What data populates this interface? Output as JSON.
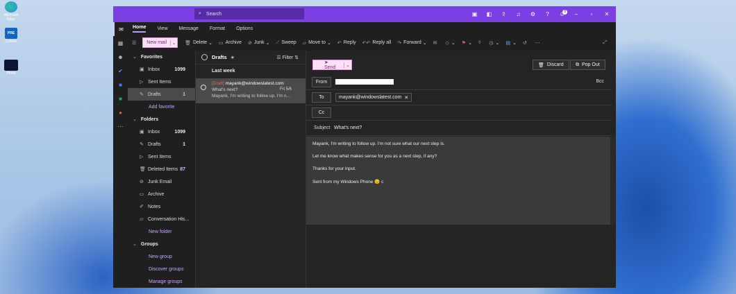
{
  "desktop": {
    "icons": [
      {
        "label": "Microsoft Edge",
        "color": "#1f8fe0"
      },
      {
        "label": "Outlook",
        "color": "#1565c0",
        "badge": "PRE"
      },
      {
        "label": "Photo",
        "color": "#0b1633"
      }
    ]
  },
  "titlebar": {
    "search_placeholder": "Search",
    "accent": "#7b3fe4",
    "icons": [
      "teams-icon",
      "word-icon",
      "share-icon",
      "bell-icon",
      "settings-icon",
      "help-icon",
      "feedback-icon"
    ],
    "badge_count": "3"
  },
  "tabs": [
    "Home",
    "View",
    "Message",
    "Format",
    "Options"
  ],
  "active_tab": "Home",
  "ribbon": {
    "new_mail": "New mail",
    "delete": "Delete",
    "archive": "Archive",
    "junk": "Junk",
    "sweep": "Sweep",
    "move_to": "Move to",
    "reply": "Reply",
    "reply_all": "Reply all",
    "forward": "Forward"
  },
  "favorites": {
    "header": "Favorites",
    "items": [
      {
        "label": "Inbox",
        "count": "1099",
        "icon": "inbox-icon"
      },
      {
        "label": "Sent Items",
        "count": "",
        "icon": "send-icon"
      },
      {
        "label": "Drafts",
        "count": "1",
        "icon": "drafts-icon",
        "selected": true
      }
    ],
    "add_favorite": "Add favorite"
  },
  "folders": {
    "header": "Folders",
    "items": [
      {
        "label": "Inbox",
        "count": "1099",
        "icon": "inbox-icon"
      },
      {
        "label": "Drafts",
        "count": "1",
        "icon": "drafts-icon"
      },
      {
        "label": "Sent Items",
        "count": "",
        "icon": "send-icon"
      },
      {
        "label": "Deleted Items",
        "count": "87",
        "icon": "trash-icon"
      },
      {
        "label": "Junk Email",
        "count": "",
        "icon": "junk-icon"
      },
      {
        "label": "Archive",
        "count": "",
        "icon": "archive-icon"
      },
      {
        "label": "Notes",
        "count": "",
        "icon": "notes-icon"
      },
      {
        "label": "Conversation His...",
        "count": "",
        "icon": "folder-icon"
      }
    ],
    "new_folder": "New folder"
  },
  "groups": {
    "header": "Groups",
    "links": [
      "New group",
      "Discover groups",
      "Manage groups"
    ]
  },
  "message_list": {
    "title": "Drafts",
    "filter": "Filter",
    "group_label": "Last week",
    "message": {
      "tag": "[Draft]",
      "to": "mayank@windowslatest.com",
      "subject": "What's next?",
      "date": "Fri 5/6",
      "preview": "Mayank, I'm writing to follow up. I'm n..."
    }
  },
  "compose": {
    "send": "Send",
    "discard": "Discard",
    "pop_out": "Pop Out",
    "from_label": "From",
    "bcc": "Bcc",
    "to_label": "To",
    "to_recipient": "mayank@windowslatest.com",
    "cc_label": "Cc",
    "subject_label": "Subject",
    "subject_value": "What's next?",
    "body": [
      "Mayank, I'm writing to follow up. I'm not sure what our next step is.",
      "Let me know what makes sense for you as a next step, if any?",
      "Thanks for your input.",
      "Sent from my Windows Phone 😊 c"
    ]
  }
}
